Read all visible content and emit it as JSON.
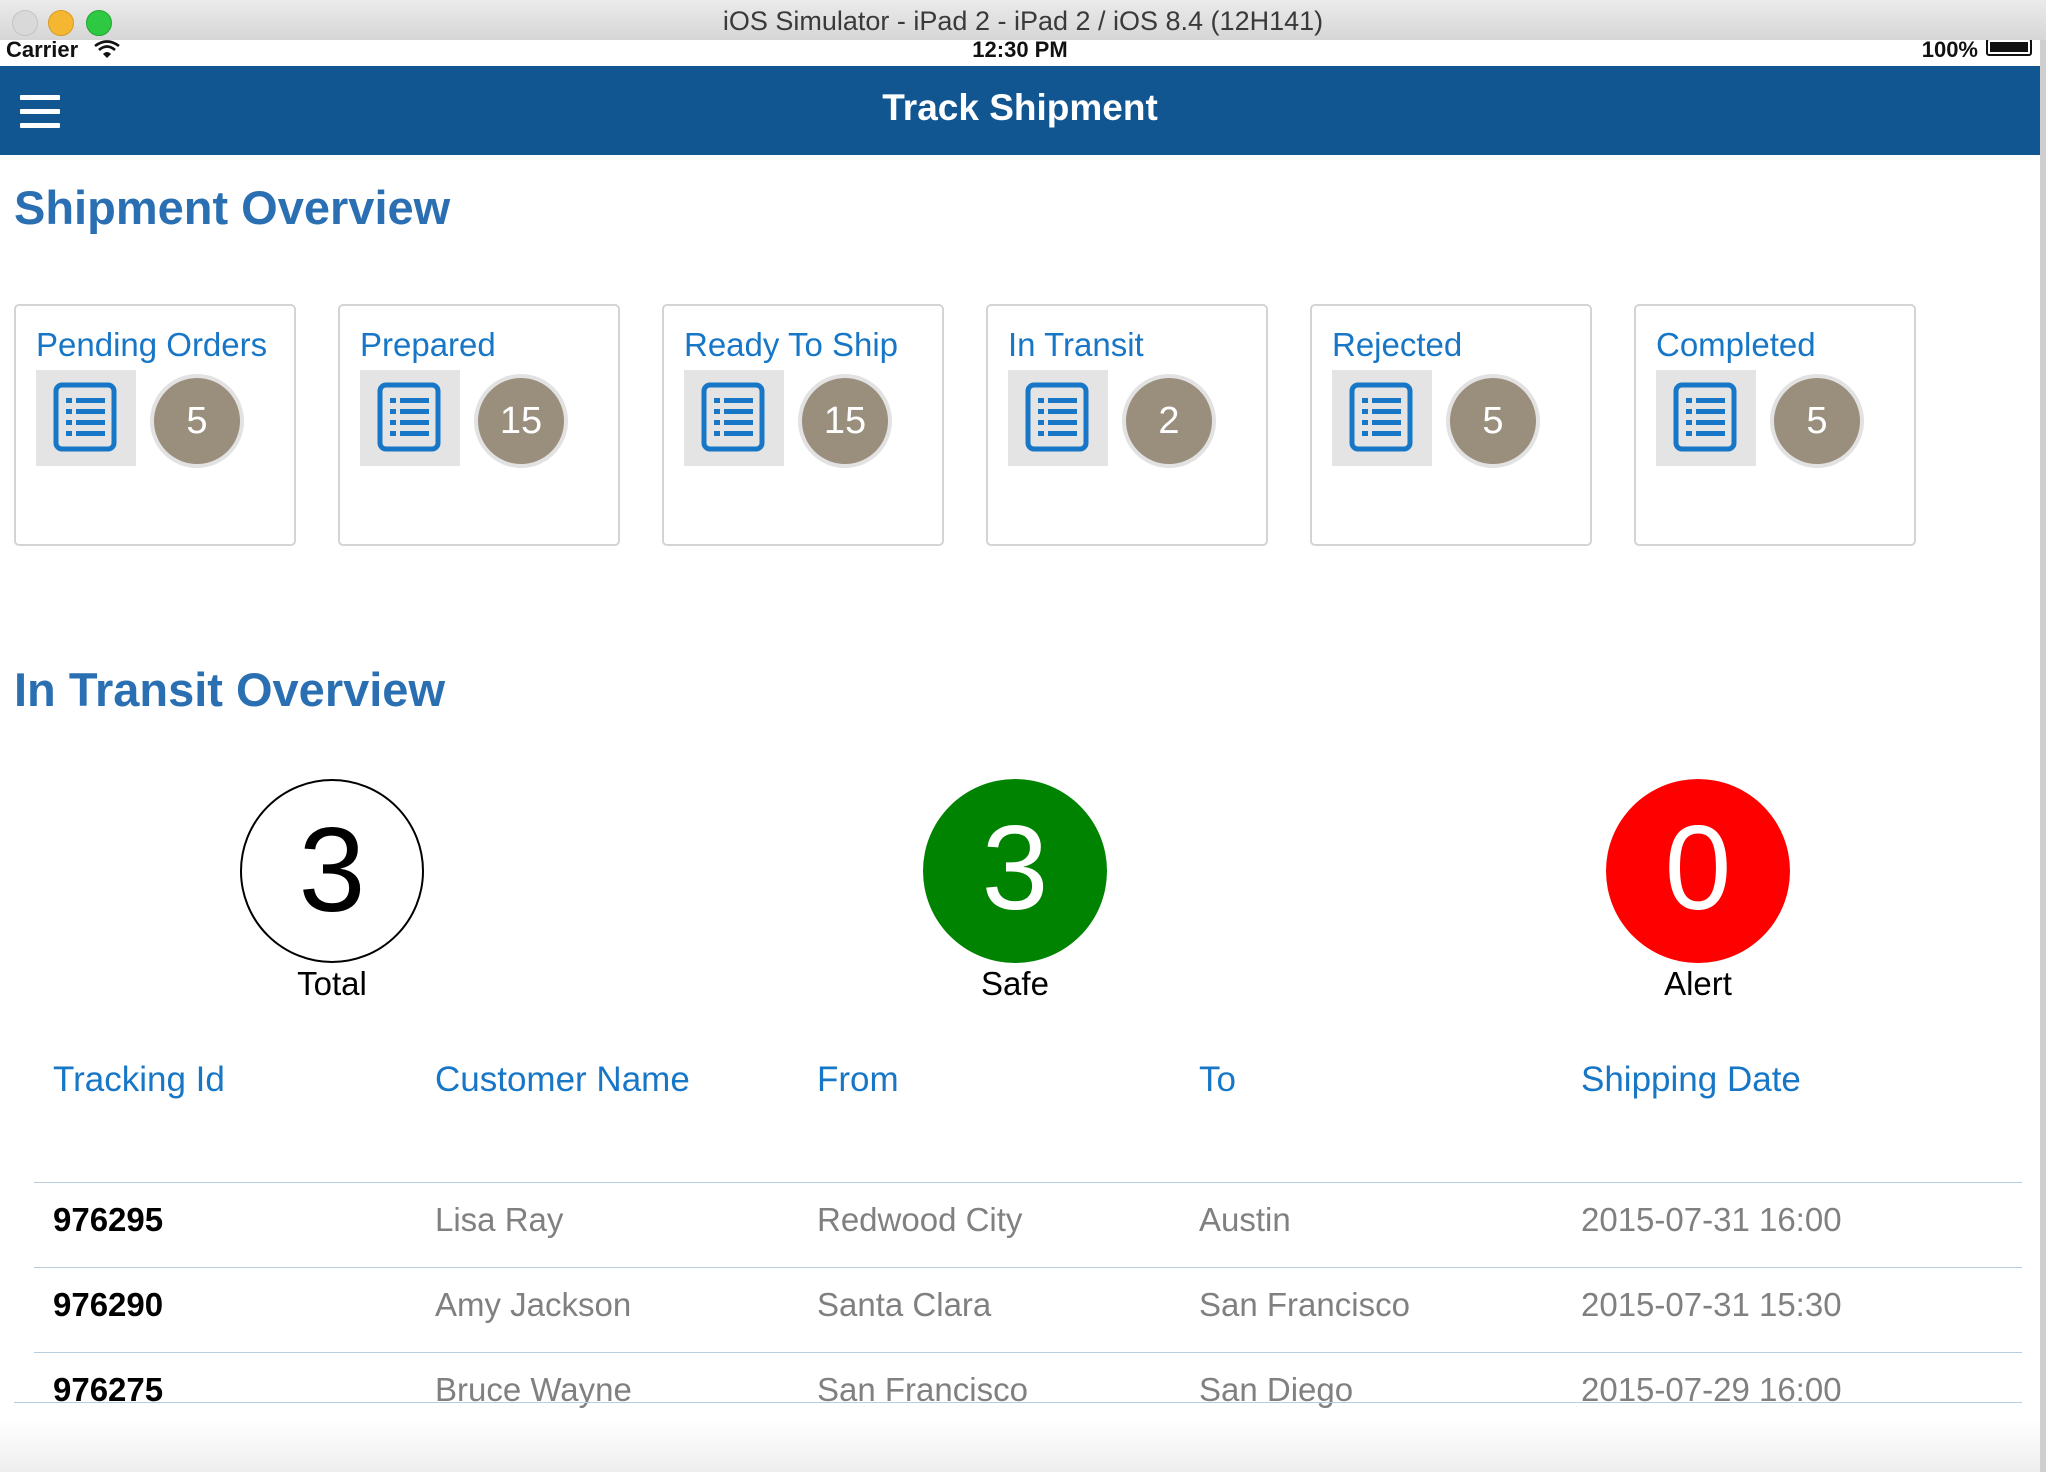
{
  "window": {
    "title": "iOS Simulator - iPad 2 - iPad 2 / iOS 8.4 (12H141)"
  },
  "status_bar": {
    "carrier": "Carrier",
    "time": "12:30 PM",
    "battery": "100%"
  },
  "navbar": {
    "title": "Track Shipment"
  },
  "shipment_overview": {
    "title": "Shipment Overview",
    "cards": [
      {
        "label": "Pending Orders",
        "count": "5"
      },
      {
        "label": "Prepared",
        "count": "15"
      },
      {
        "label": "Ready To Ship",
        "count": "15"
      },
      {
        "label": "In Transit",
        "count": "2"
      },
      {
        "label": "Rejected",
        "count": "5"
      },
      {
        "label": "Completed",
        "count": "5"
      }
    ]
  },
  "transit_overview": {
    "title": "In Transit Overview",
    "stats": [
      {
        "label": "Total",
        "value": "3"
      },
      {
        "label": "Safe",
        "value": "3"
      },
      {
        "label": "Alert",
        "value": "0"
      }
    ]
  },
  "table": {
    "headers": [
      "Tracking Id",
      "Customer Name",
      "From",
      "To",
      "Shipping Date"
    ],
    "rows": [
      [
        "976295",
        "Lisa Ray",
        "Redwood City",
        "Austin",
        "2015-07-31 16:00"
      ],
      [
        "976290",
        "Amy Jackson",
        "Santa Clara",
        "San Francisco",
        "2015-07-31 15:30"
      ],
      [
        "976275",
        "Bruce Wayne",
        "San Francisco",
        "San Diego",
        "2015-07-29 16:00"
      ]
    ]
  },
  "colors": {
    "navbar": "#115591",
    "section_title": "#2b6fb3",
    "link_blue": "#1777c6",
    "badge": "#9a8e7d",
    "safe": "#008300",
    "alert": "#ff0000"
  }
}
